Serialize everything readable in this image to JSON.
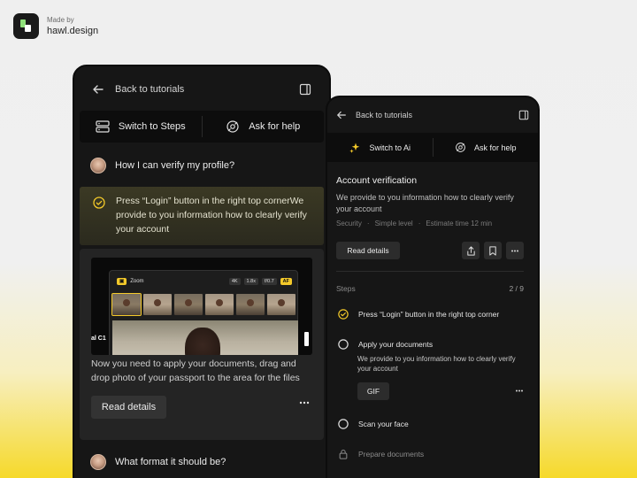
{
  "brand": {
    "made_by": "Made by",
    "name": "hawl.design"
  },
  "phone_left": {
    "back_label": "Back to tutorials",
    "switch_left": "Switch to Steps",
    "switch_right": "Ask for help",
    "question_1": "How I can verify my profile?",
    "highlight_text": "Press “Login” button in the right top cornerWe provide to you information how to clearly verify your account",
    "media": {
      "app_name": "Zoom",
      "chips": [
        "4K",
        "1.8x",
        "f/0.7",
        "AF"
      ],
      "side_label": "al C1"
    },
    "description": "Now you need to apply your documents, drag and drop photo of your passport to the area for the files",
    "read_details": "Read details",
    "question_2": "What format it should be?"
  },
  "phone_right": {
    "back_label": "Back to tutorials",
    "switch_left": "Switch to Ai",
    "switch_right": "Ask for help",
    "heading": "Account verification",
    "subtext": "We provide to you information how to clearly verify your account",
    "meta": [
      "Security",
      "Simple level",
      "Estimate time 12 min"
    ],
    "meta_sep": "·",
    "read_details": "Read details",
    "steps_label": "Steps",
    "steps_count": "2 / 9",
    "steps": [
      {
        "label": "Press “Login” button in the right top corner",
        "state": "done"
      },
      {
        "label": "Apply your documents",
        "state": "active",
        "detail": "We provide to you information how to clearly verify your account",
        "button": "GIF"
      },
      {
        "label": "Scan your face",
        "state": "todo"
      },
      {
        "label": "Prepare documents",
        "state": "locked"
      }
    ]
  },
  "colors": {
    "accent": "#f3c92a",
    "panel": "#161616",
    "background_bottom": "#f6d92a"
  }
}
